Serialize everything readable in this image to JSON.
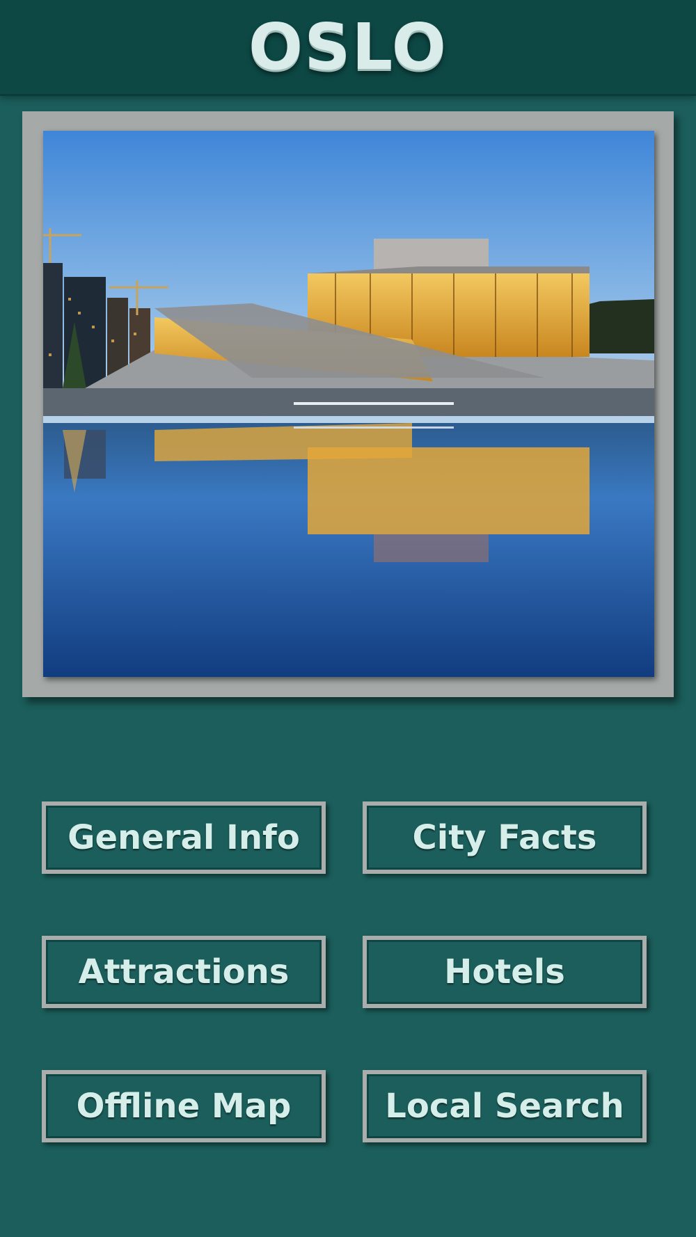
{
  "header": {
    "title": "OSLO"
  },
  "hero": {
    "subject": "oslo-opera-house-photo"
  },
  "menu": {
    "buttons": [
      {
        "label": "General Info"
      },
      {
        "label": "City Facts"
      },
      {
        "label": "Attractions"
      },
      {
        "label": "Hotels"
      },
      {
        "label": "Offline Map"
      },
      {
        "label": "Local Search"
      }
    ]
  },
  "colors": {
    "background": "#1b5e5b",
    "header": "#0d4845",
    "frame": "#a5aaa8",
    "button_text": "#d6eeea"
  }
}
